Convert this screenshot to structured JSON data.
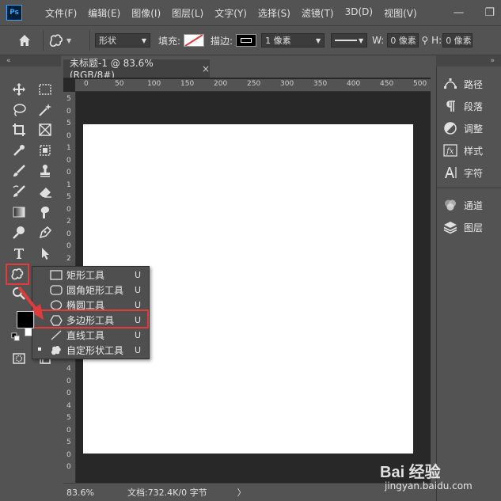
{
  "menubar": {
    "logo": "Ps",
    "items": [
      "文件(F)",
      "编辑(E)",
      "图像(I)",
      "图层(L)",
      "文字(Y)",
      "选择(S)",
      "滤镜(T)",
      "3D(D)",
      "视图(V)"
    ],
    "minimize": "—",
    "restore": "❐"
  },
  "options": {
    "mode_value": "形状",
    "fill_label": "填充:",
    "stroke_label": "描边:",
    "stroke_width": "1 像素",
    "w_label": "W:",
    "w_value": "0 像素",
    "h_label": "H:",
    "h_value": "0 像素"
  },
  "document": {
    "tab_title": "未标题-1 @ 83.6%(RGB/8#)",
    "tab_close": "×",
    "ruler_h": [
      "0",
      "50",
      "100",
      "150",
      "200",
      "250",
      "300",
      "350",
      "400",
      "450",
      "500"
    ],
    "ruler_v": [
      "5",
      "0",
      "5",
      "0",
      "1",
      "0",
      "0",
      "1",
      "5",
      "0",
      "2",
      "0",
      "0",
      "2",
      "5",
      "0",
      "3",
      "0",
      "0",
      "3",
      "5",
      "0",
      "4",
      "0",
      "0",
      "4",
      "5",
      "0",
      "5",
      "0",
      "0"
    ],
    "zoom": "83.6%",
    "doc_info": "文档:732.4K/0 字节",
    "status_arrow": "〉"
  },
  "left_panel": {
    "collapse": "«"
  },
  "right_panel": {
    "collapse": "»",
    "items": [
      {
        "label": "路径",
        "icon": "paths-icon"
      },
      {
        "label": "段落",
        "icon": "paragraph-icon"
      },
      {
        "label": "调整",
        "icon": "adjustments-icon"
      },
      {
        "label": "样式",
        "icon": "styles-icon"
      },
      {
        "label": "字符",
        "icon": "character-icon"
      },
      {
        "label": "通道",
        "icon": "channels-icon"
      },
      {
        "label": "图层",
        "icon": "layers-icon"
      }
    ]
  },
  "flyout": {
    "items": [
      {
        "label": "矩形工具",
        "shortcut": "U"
      },
      {
        "label": "圆角矩形工具",
        "shortcut": "U"
      },
      {
        "label": "椭圆工具",
        "shortcut": "U"
      },
      {
        "label": "多边形工具",
        "shortcut": "U"
      },
      {
        "label": "直线工具",
        "shortcut": "U"
      },
      {
        "label": "自定形状工具",
        "shortcut": "U"
      }
    ],
    "selected_index": 5,
    "highlighted_index": 3
  },
  "watermark": {
    "brand": "Bai 经验",
    "url": "jingyan.baidu.com"
  },
  "colors": {
    "highlight": "#e23b3b",
    "canvas": "#ffffff",
    "pasteboard": "#282828"
  }
}
